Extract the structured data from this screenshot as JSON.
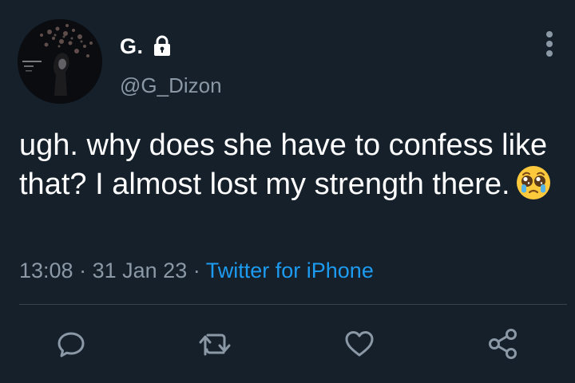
{
  "tweet": {
    "display_name": "G.",
    "handle": "@G_Dizon",
    "text_main": "ugh. why does she have to confess like that? I almost lost my strength there.",
    "emoji": "pleading-face-with-tears",
    "time": "13:08",
    "separator": "·",
    "date": "31 Jan 23",
    "source": "Twitter for iPhone",
    "protected_icon": "lock-icon"
  },
  "actions": [
    {
      "icon": "reply-icon"
    },
    {
      "icon": "retweet-icon"
    },
    {
      "icon": "like-icon"
    },
    {
      "icon": "share-icon"
    }
  ],
  "colors": {
    "background": "#15202b",
    "text": "#ffffff",
    "secondary": "#8b98a5",
    "link": "#1d9bf0",
    "divider": "#38444d"
  }
}
